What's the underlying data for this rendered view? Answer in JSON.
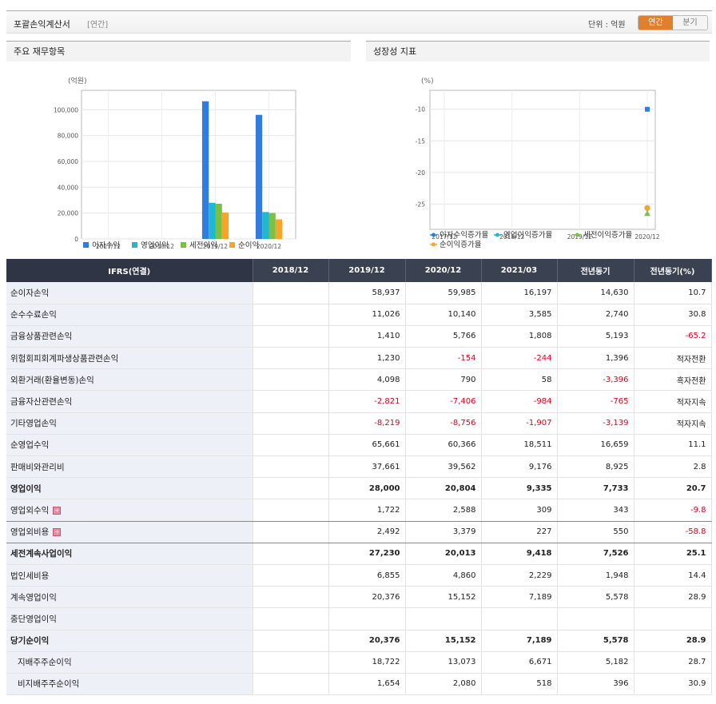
{
  "header": {
    "title": "포괄손익계산서",
    "subtitle": "[연간]",
    "unit": "단위 : 억원",
    "tabs": [
      "연간",
      "분기"
    ]
  },
  "left_panel": {
    "title": "주요 재무항목"
  },
  "right_panel": {
    "title": "성장성 지표"
  },
  "chart_data": [
    {
      "type": "bar",
      "ylabel": "(억원)",
      "categories": [
        "2017/12",
        "2018/12",
        "2019/12",
        "2020/12"
      ],
      "y_ticks": [
        "0",
        "20,000",
        "40,000",
        "60,000",
        "80,000",
        "100,000"
      ],
      "ylim": [
        0,
        115000
      ],
      "grid": true,
      "legend_position": "bottom",
      "series": [
        {
          "name": "이자수익",
          "color": "#2f7ddf",
          "values": [
            null,
            null,
            106500,
            96000
          ]
        },
        {
          "name": "영업이익",
          "color": "#1fb8d0",
          "values": [
            null,
            null,
            28000,
            20804
          ]
        },
        {
          "name": "세전이익",
          "color": "#7bc043",
          "values": [
            null,
            null,
            27230,
            20013
          ]
        },
        {
          "name": "순이익",
          "color": "#f7a42a",
          "values": [
            null,
            null,
            20376,
            15152
          ]
        }
      ]
    },
    {
      "type": "scatter",
      "ylabel": "(%)",
      "categories": [
        "2017/12",
        "2018/12",
        "2019/12",
        "2020/12"
      ],
      "y_ticks": [
        "-10",
        "-15",
        "-20",
        "-25"
      ],
      "ylim": [
        -29,
        -7
      ],
      "grid": true,
      "legend_position": "bottom",
      "series": [
        {
          "name": "이자수익증가율",
          "color": "#2f7ddf",
          "values": [
            null,
            null,
            null,
            -10
          ]
        },
        {
          "name": "영업이익증가율",
          "color": "#1fb8d0",
          "values": [
            null,
            null,
            null,
            -25.7
          ]
        },
        {
          "name": "세전이익증가율",
          "color": "#7bc043",
          "values": [
            null,
            null,
            null,
            -26.5
          ]
        },
        {
          "name": "순이익증가율",
          "color": "#f7a42a",
          "values": [
            null,
            null,
            null,
            -25.6
          ]
        }
      ]
    }
  ],
  "table": {
    "columns": [
      "IFRS(연결)",
      "2018/12",
      "2019/12",
      "2020/12",
      "2021/03",
      "전년동기",
      "전년동기(%)"
    ],
    "rows": [
      {
        "label": "순이자손익",
        "values": [
          "",
          "58,937",
          "59,985",
          "16,197",
          "14,630",
          "10.7"
        ]
      },
      {
        "label": "순수수료손익",
        "values": [
          "",
          "11,026",
          "10,140",
          "3,585",
          "2,740",
          "30.8"
        ]
      },
      {
        "label": "금융상품관련손익",
        "values": [
          "",
          "1,410",
          "5,766",
          "1,808",
          "5,193",
          "-65.2"
        ]
      },
      {
        "label": "위험회피회계파생상품관련손익",
        "values": [
          "",
          "1,230",
          "-154",
          "-244",
          "1,396",
          "적자전환"
        ]
      },
      {
        "label": "외환거래(환율변동)손익",
        "values": [
          "",
          "4,098",
          "790",
          "58",
          "-3,396",
          "흑자전환"
        ]
      },
      {
        "label": "금융자산관련손익",
        "values": [
          "",
          "-2,821",
          "-7,406",
          "-984",
          "-765",
          "적자지속"
        ]
      },
      {
        "label": "기타영업손익",
        "values": [
          "",
          "-8,219",
          "-8,756",
          "-1,907",
          "-3,139",
          "적자지속"
        ]
      },
      {
        "label": "순영업수익",
        "values": [
          "",
          "65,661",
          "60,366",
          "18,511",
          "16,659",
          "11.1"
        ]
      },
      {
        "label": "판매비와관리비",
        "values": [
          "",
          "37,661",
          "39,562",
          "9,176",
          "8,925",
          "2.8"
        ]
      },
      {
        "label": "영업이익",
        "values": [
          "",
          "28,000",
          "20,804",
          "9,335",
          "7,733",
          "20.7"
        ]
      },
      {
        "label": "영업외수익",
        "values": [
          "",
          "1,722",
          "2,588",
          "309",
          "343",
          "-9.8"
        ]
      },
      {
        "label": "영업외비용",
        "values": [
          "",
          "2,492",
          "3,379",
          "227",
          "550",
          "-58.8"
        ]
      },
      {
        "label": "세전계속사업이익",
        "values": [
          "",
          "27,230",
          "20,013",
          "9,418",
          "7,526",
          "25.1"
        ]
      },
      {
        "label": "법인세비용",
        "values": [
          "",
          "6,855",
          "4,860",
          "2,229",
          "1,948",
          "14.4"
        ]
      },
      {
        "label": "계속영업이익",
        "values": [
          "",
          "20,376",
          "15,152",
          "7,189",
          "5,578",
          "28.9"
        ]
      },
      {
        "label": "중단영업이익",
        "values": [
          "",
          "",
          "",
          "",
          "",
          ""
        ]
      },
      {
        "label": "당기순이익",
        "values": [
          "",
          "20,376",
          "15,152",
          "7,189",
          "5,578",
          "28.9"
        ]
      },
      {
        "label": "지배주주순이익",
        "values": [
          "",
          "18,722",
          "13,073",
          "6,671",
          "5,182",
          "28.7"
        ]
      },
      {
        "label": "비지배주주순이익",
        "values": [
          "",
          "1,654",
          "2,080",
          "518",
          "396",
          "30.9"
        ]
      }
    ]
  }
}
